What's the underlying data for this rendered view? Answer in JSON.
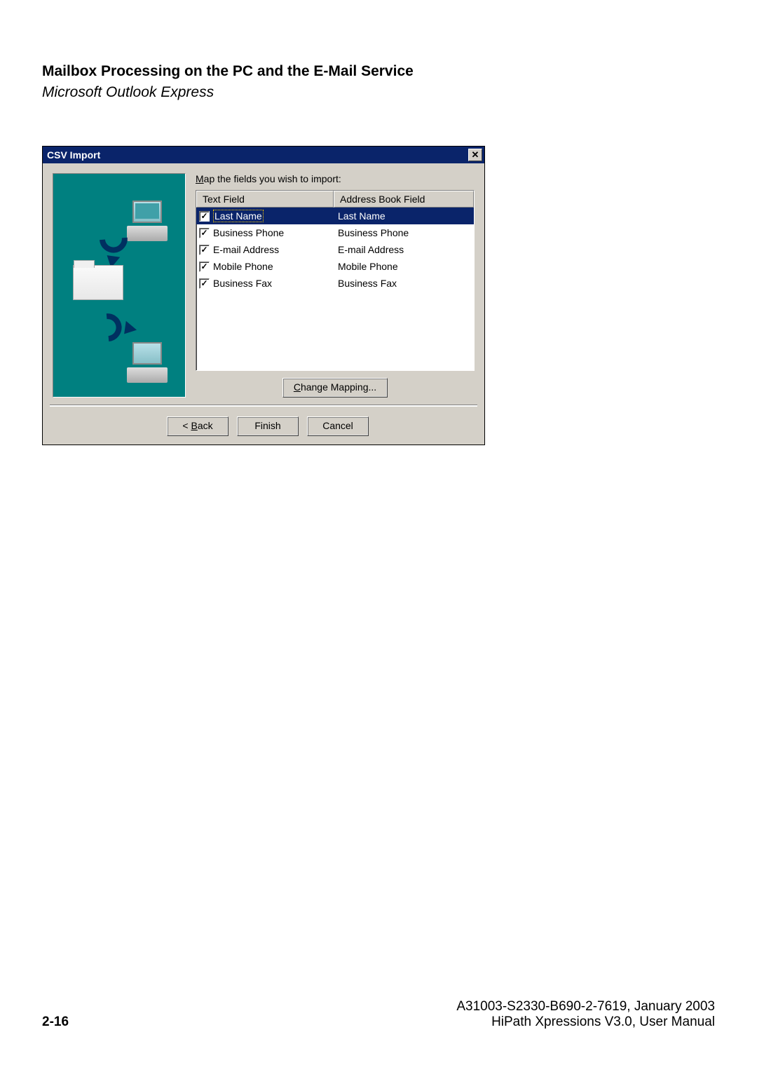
{
  "header": {
    "title": "Mailbox Processing on the PC and the E-Mail Service",
    "subtitle": "Microsoft Outlook Express"
  },
  "dialog": {
    "title": "CSV Import",
    "map_label_pre": "M",
    "map_label_rest": "ap the fields you wish to import:",
    "columns": {
      "text_field": "Text Field",
      "address_book_field": "Address Book Field"
    },
    "rows": [
      {
        "checked": true,
        "selected": true,
        "text": "Last Name",
        "abf": "Last Name"
      },
      {
        "checked": true,
        "selected": false,
        "text": "Business Phone",
        "abf": "Business Phone"
      },
      {
        "checked": true,
        "selected": false,
        "text": "E-mail Address",
        "abf": "E-mail Address"
      },
      {
        "checked": true,
        "selected": false,
        "text": "Mobile Phone",
        "abf": "Mobile Phone"
      },
      {
        "checked": true,
        "selected": false,
        "text": "Business Fax",
        "abf": "Business Fax"
      }
    ],
    "buttons": {
      "change_pre": "C",
      "change_rest": "hange Mapping...",
      "back_pre": "< ",
      "back_ul": "B",
      "back_rest": "ack",
      "finish": "Finish",
      "cancel": "Cancel"
    }
  },
  "footer": {
    "page": "2-16",
    "doc_line1": "A31003-S2330-B690-2-7619, January 2003",
    "doc_line2": "HiPath Xpressions V3.0, User Manual"
  }
}
